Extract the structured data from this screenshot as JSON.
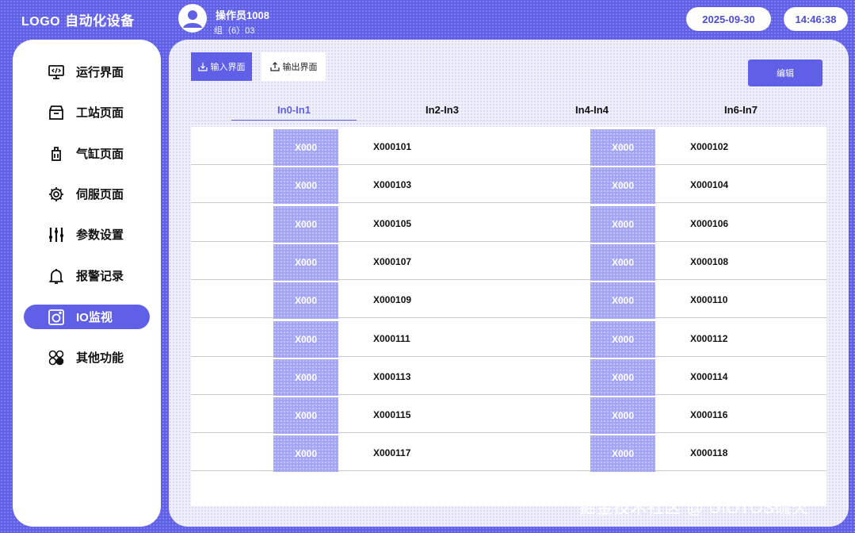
{
  "header": {
    "logo": "LOGO",
    "system_title": "自动化设备",
    "user_name": "操作员1008",
    "user_group": "组（6）03",
    "date": "2025-09-30",
    "time": "14:46:38"
  },
  "sidebar": {
    "items": [
      {
        "label": "运行界面",
        "icon": "monitor-code-icon",
        "active": false
      },
      {
        "label": "工站页面",
        "icon": "box-icon",
        "active": false
      },
      {
        "label": "气缸页面",
        "icon": "cylinder-icon",
        "active": false
      },
      {
        "label": "伺服页面",
        "icon": "gear-icon",
        "active": false
      },
      {
        "label": "参数设置",
        "icon": "sliders-icon",
        "active": false
      },
      {
        "label": "报警记录",
        "icon": "bell-icon",
        "active": false
      },
      {
        "label": "IO监视",
        "icon": "camera-icon",
        "active": true
      },
      {
        "label": "其他功能",
        "icon": "apps-icon",
        "active": false
      }
    ]
  },
  "toolbar": {
    "input_label": "输入界面",
    "output_label": "输出界面",
    "edit_label": "编辑"
  },
  "tabs": [
    {
      "label": "In0-In1",
      "active": true
    },
    {
      "label": "In2-In3",
      "active": false
    },
    {
      "label": "In4-In4",
      "active": false
    },
    {
      "label": "In6-In7",
      "active": false
    }
  ],
  "io_table": {
    "rows": [
      {
        "left_badge": "X000",
        "left_label": "X000101",
        "right_badge": "X000",
        "right_label": "X000102"
      },
      {
        "left_badge": "X000",
        "left_label": "X000103",
        "right_badge": "X000",
        "right_label": "X000104"
      },
      {
        "left_badge": "X000",
        "left_label": "X000105",
        "right_badge": "X000",
        "right_label": "X000106"
      },
      {
        "left_badge": "X000",
        "left_label": "X000107",
        "right_badge": "X000",
        "right_label": "X000108"
      },
      {
        "left_badge": "X000",
        "left_label": "X000109",
        "right_badge": "X000",
        "right_label": "X000110"
      },
      {
        "left_badge": "X000",
        "left_label": "X000111",
        "right_badge": "X000",
        "right_label": "X000112"
      },
      {
        "left_badge": "X000",
        "left_label": "X000113",
        "right_badge": "X000",
        "right_label": "X000114"
      },
      {
        "left_badge": "X000",
        "left_label": "X000115",
        "right_badge": "X000",
        "right_label": "X000116"
      },
      {
        "left_badge": "X000",
        "left_label": "X000117",
        "right_badge": "X000",
        "right_label": "X000118"
      }
    ]
  },
  "watermark": "掘金技术社区 @ UIOTOS硫火",
  "colors": {
    "accent": "#5f5fe8",
    "badge": "#a4a4f4",
    "panel": "#f0f0fb"
  }
}
